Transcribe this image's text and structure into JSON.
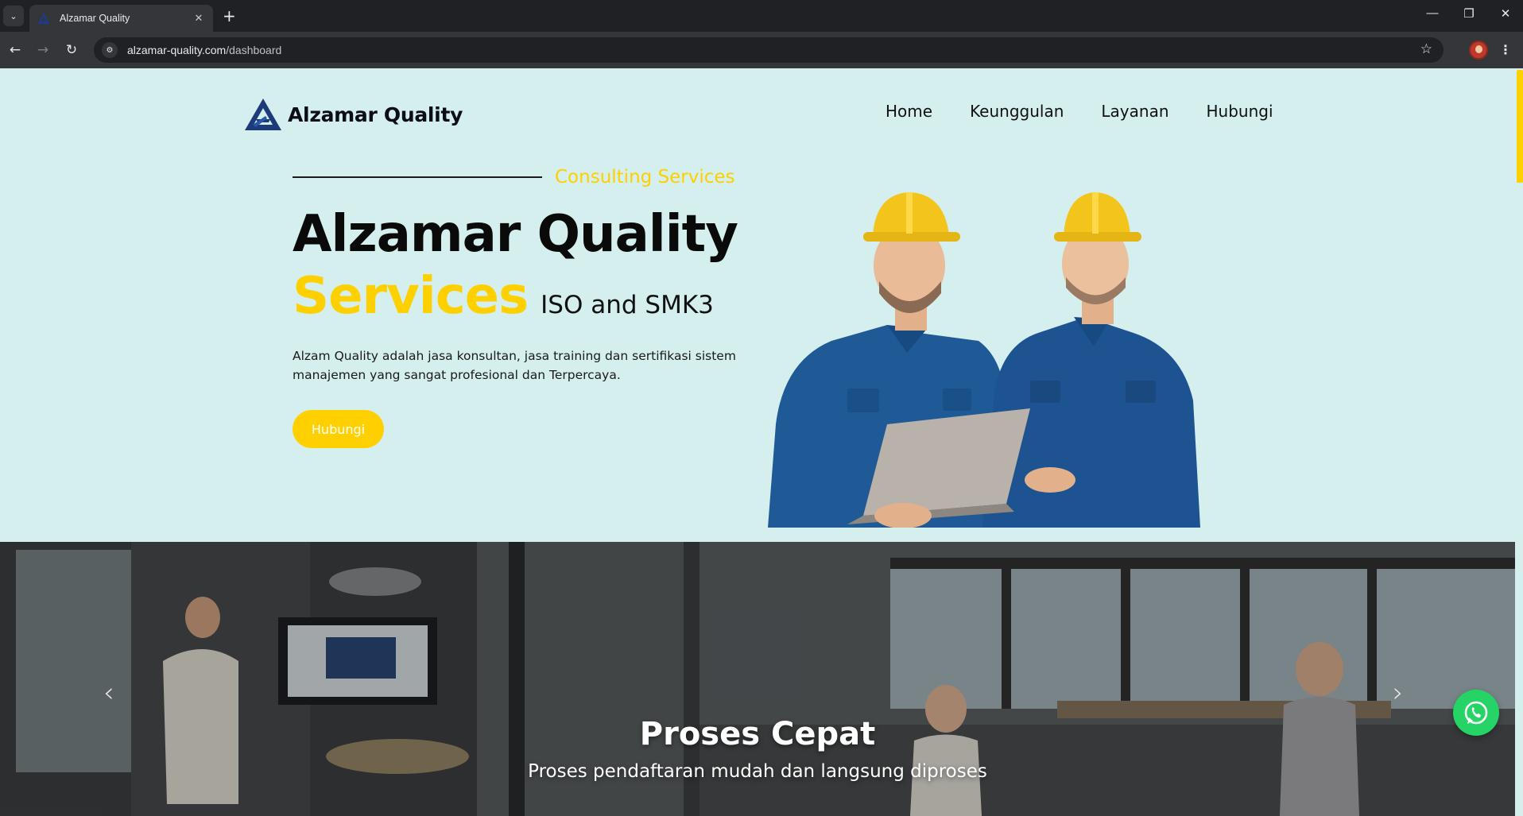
{
  "browser": {
    "tab_title": "Alzamar Quality",
    "url_domain": "alzamar-quality.com",
    "url_path": "/dashboard",
    "icons": [
      "tab-search-icon",
      "favicon",
      "close-icon",
      "new-tab-icon",
      "minimize-icon",
      "maximize-icon",
      "window-close-icon",
      "back-icon",
      "forward-icon",
      "reload-icon",
      "site-info-icon",
      "bookmark-star-icon",
      "profile-avatar",
      "menu-icon"
    ]
  },
  "site": {
    "brand": "Alzamar Quality",
    "nav": [
      "Home",
      "Keunggulan",
      "Layanan",
      "Hubungi"
    ]
  },
  "hero": {
    "eyebrow": "Consulting Services",
    "title": "Alzamar Quality",
    "subtitle_highlight": "Services",
    "subtitle_rest": "ISO and SMK3",
    "description": "Alzam Quality adalah jasa konsultan, jasa training dan sertifikasi sistem manajemen yang sangat profesional dan Terpercaya.",
    "cta": "Hubungi"
  },
  "carousel": {
    "slide_title": "Proses Cepat",
    "slide_text": "Proses pendaftaran mudah dan langsung diproses"
  },
  "colors": {
    "accent": "#ffd000",
    "page_bg": "#d4efee",
    "whatsapp": "#25d366",
    "shirt": "#1f5a96"
  }
}
